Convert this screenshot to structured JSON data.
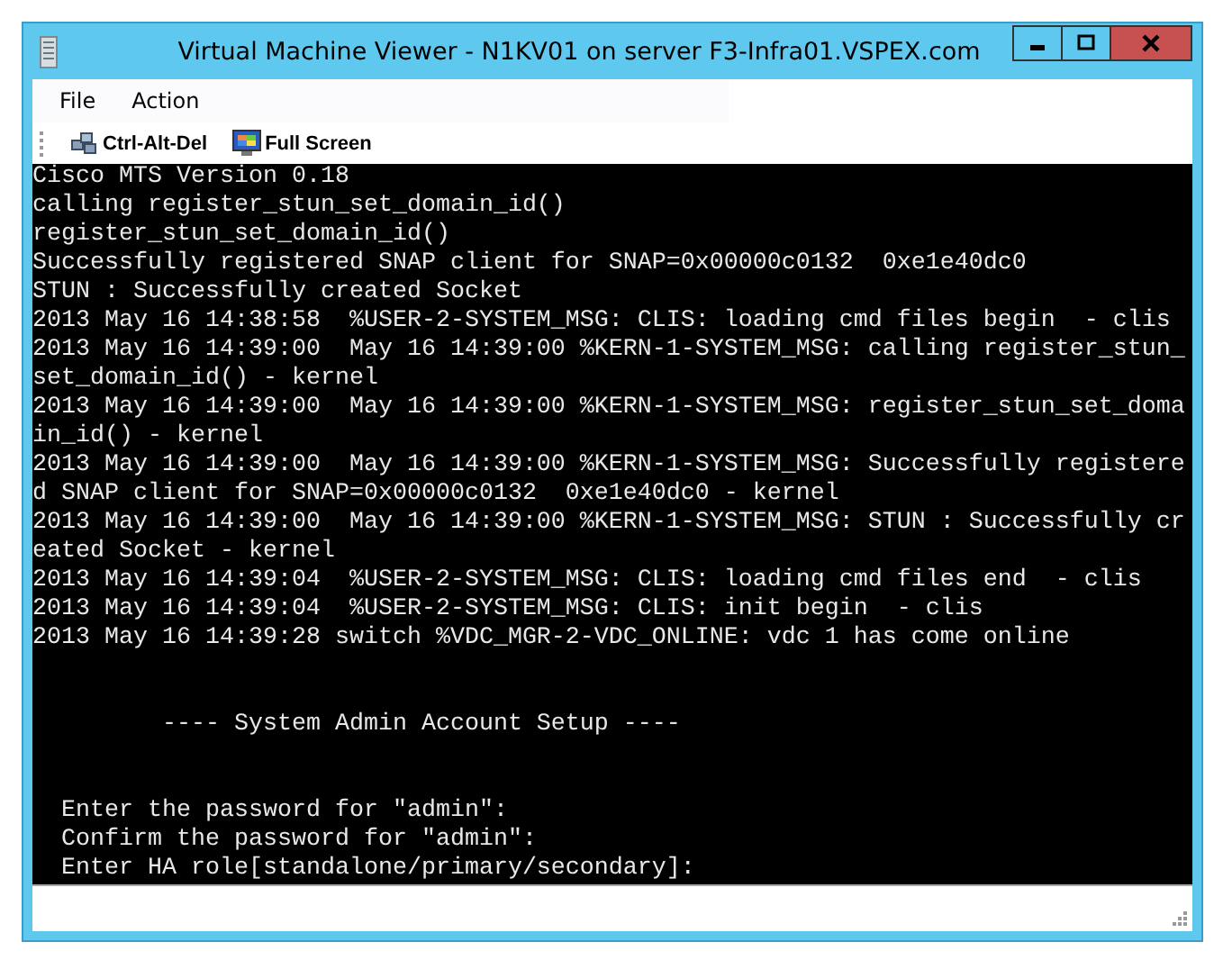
{
  "window": {
    "title": "Virtual Machine Viewer - N1KV01 on server F3-Infra01.VSPEX.com"
  },
  "menu": [
    "File",
    "Action"
  ],
  "toolbar": [
    {
      "label": "Ctrl-Alt-Del",
      "kind": "keys"
    },
    {
      "label": "Full Screen",
      "kind": "monitor"
    }
  ],
  "console": {
    "sections": [
      [
        "Cisco MTS Version 0.18",
        "calling register_stun_set_domain_id()",
        "register_stun_set_domain_id()",
        "Successfully registered SNAP client for SNAP=0x00000c0132  0xe1e40dc0",
        "STUN : Successfully created Socket",
        "2013 May 16 14:38:58  %USER-2-SYSTEM_MSG: CLIS: loading cmd files begin  - clis",
        "2013 May 16 14:39:00  May 16 14:39:00 %KERN-1-SYSTEM_MSG: calling register_stun_",
        "set_domain_id() - kernel",
        "2013 May 16 14:39:00  May 16 14:39:00 %KERN-1-SYSTEM_MSG: register_stun_set_doma",
        "in_id() - kernel",
        "2013 May 16 14:39:00  May 16 14:39:00 %KERN-1-SYSTEM_MSG: Successfully registere",
        "d SNAP client for SNAP=0x00000c0132  0xe1e40dc0 - kernel",
        "2013 May 16 14:39:00  May 16 14:39:00 %KERN-1-SYSTEM_MSG: STUN : Successfully cr",
        "eated Socket - kernel",
        "2013 May 16 14:39:04  %USER-2-SYSTEM_MSG: CLIS: loading cmd files end  - clis",
        "2013 May 16 14:39:04  %USER-2-SYSTEM_MSG: CLIS: init begin  - clis",
        "2013 May 16 14:39:28 switch %VDC_MGR-2-VDC_ONLINE: vdc 1 has come online"
      ],
      [
        "         ---- System Admin Account Setup ----"
      ],
      [
        "  Enter the password for \"admin\":",
        "  Confirm the password for \"admin\":",
        "  Enter HA role[standalone/primary/secondary]:"
      ]
    ]
  }
}
